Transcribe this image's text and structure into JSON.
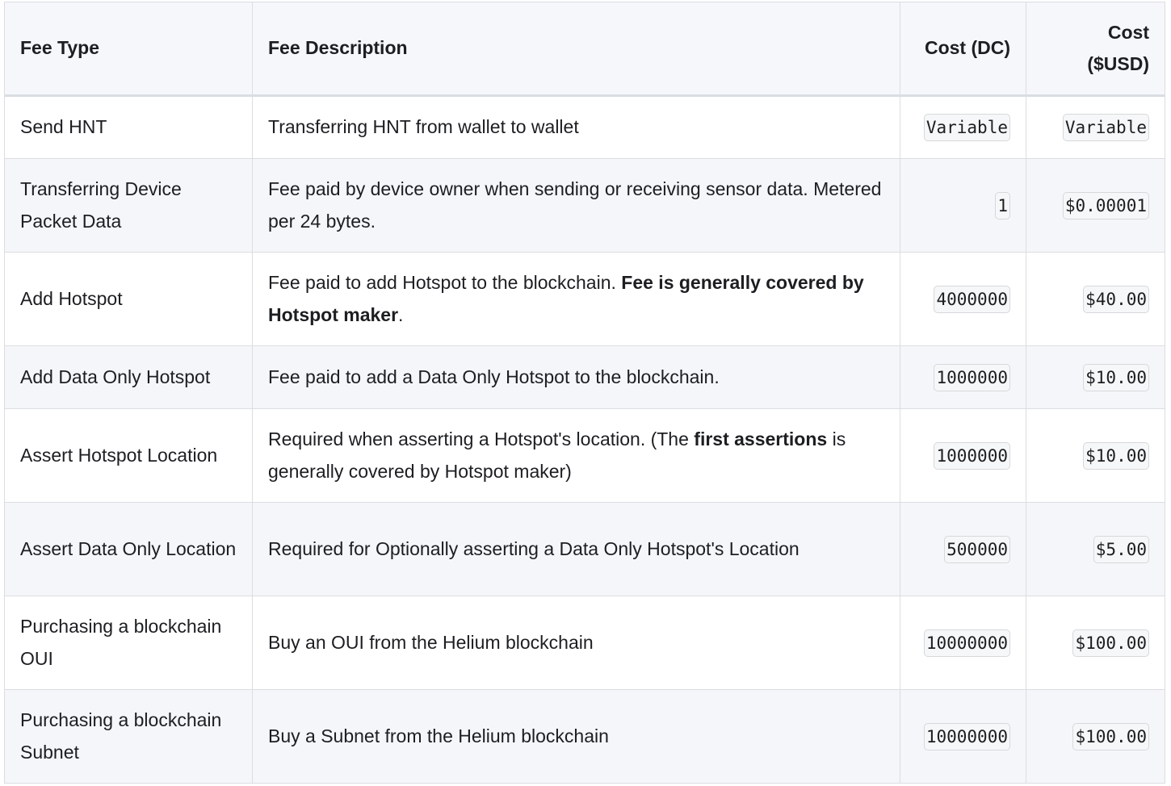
{
  "table": {
    "headers": {
      "fee_type": "Fee Type",
      "fee_description": "Fee Description",
      "cost_dc": "Cost (DC)",
      "cost_usd": "Cost ($USD)"
    },
    "rows": [
      {
        "fee_type": "Send HNT",
        "description": {
          "pre": "Transferring HNT from wallet to wallet",
          "bold": "",
          "post": ""
        },
        "cost_dc": "Variable",
        "cost_usd": "Variable"
      },
      {
        "fee_type": "Transferring Device Packet Data",
        "description": {
          "pre": "Fee paid by device owner when sending or receiving sensor data. Metered per 24 bytes.",
          "bold": "",
          "post": ""
        },
        "cost_dc": "1",
        "cost_usd": "$0.00001"
      },
      {
        "fee_type": "Add Hotspot",
        "description": {
          "pre": "Fee paid to add Hotspot to the blockchain. ",
          "bold": "Fee is generally covered by Hotspot maker",
          "post": "."
        },
        "cost_dc": "4000000",
        "cost_usd": "$40.00"
      },
      {
        "fee_type": "Add Data Only Hotspot",
        "description": {
          "pre": "Fee paid to add a Data Only Hotspot to the blockchain.",
          "bold": "",
          "post": ""
        },
        "cost_dc": "1000000",
        "cost_usd": "$10.00"
      },
      {
        "fee_type": "Assert Hotspot Location",
        "description": {
          "pre": "Required when asserting a Hotspot's location. (The ",
          "bold": "first assertions",
          "post": " is generally covered by Hotspot maker)"
        },
        "cost_dc": "1000000",
        "cost_usd": "$10.00"
      },
      {
        "fee_type": "Assert Data Only Location",
        "description": {
          "pre": "Required for Optionally asserting a Data Only Hotspot's Location",
          "bold": "",
          "post": ""
        },
        "cost_dc": "500000",
        "cost_usd": "$5.00"
      },
      {
        "fee_type": "Purchasing a blockchain OUI",
        "description": {
          "pre": "Buy an OUI from the Helium blockchain",
          "bold": "",
          "post": ""
        },
        "cost_dc": "10000000",
        "cost_usd": "$100.00"
      },
      {
        "fee_type": "Purchasing a blockchain Subnet",
        "description": {
          "pre": "Buy a Subnet from the Helium blockchain",
          "bold": "",
          "post": ""
        },
        "cost_dc": "10000000",
        "cost_usd": "$100.00"
      }
    ]
  }
}
